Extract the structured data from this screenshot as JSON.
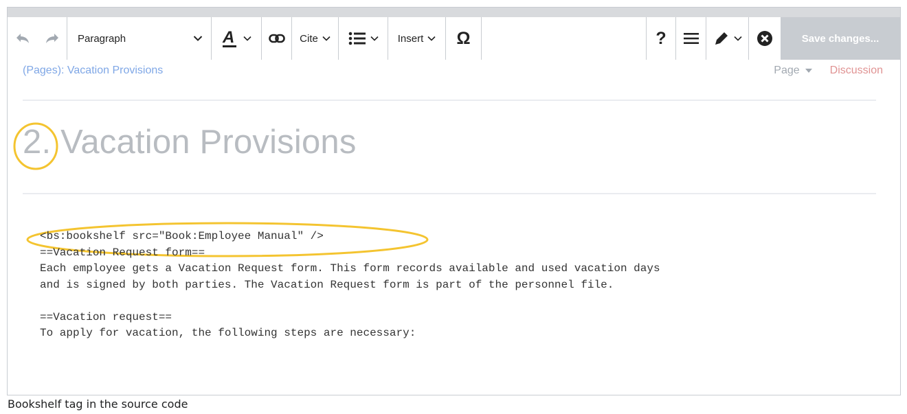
{
  "toolbar": {
    "paragraph_label": "Paragraph",
    "cite_label": "Cite",
    "insert_label": "Insert",
    "special_char_label": "Ω",
    "help_label": "?",
    "save_label": "Save changes..."
  },
  "breadcrumb": "(Pages):  Vacation Provisions",
  "page_tabs": {
    "page": "Page",
    "discussion": "Discussion"
  },
  "heading": "2. Vacation Provisions",
  "source_lines": [
    "<bs:bookshelf src=\"Book:Employee Manual\" />",
    "==Vacation Request form==",
    "Each employee gets a Vacation Request form. This form records available and used vacation days",
    "and is signed by both parties. The Vacation Request form is part of the personnel file.",
    "",
    "==Vacation request==",
    "To apply for vacation, the following steps are necessary:"
  ],
  "caption": "Bookshelf tag in the source code",
  "colors": {
    "highlight": "#f4c430",
    "link": "#7fa7e6",
    "discussion": "#e09393",
    "save_bg": "#c8ccd1"
  }
}
